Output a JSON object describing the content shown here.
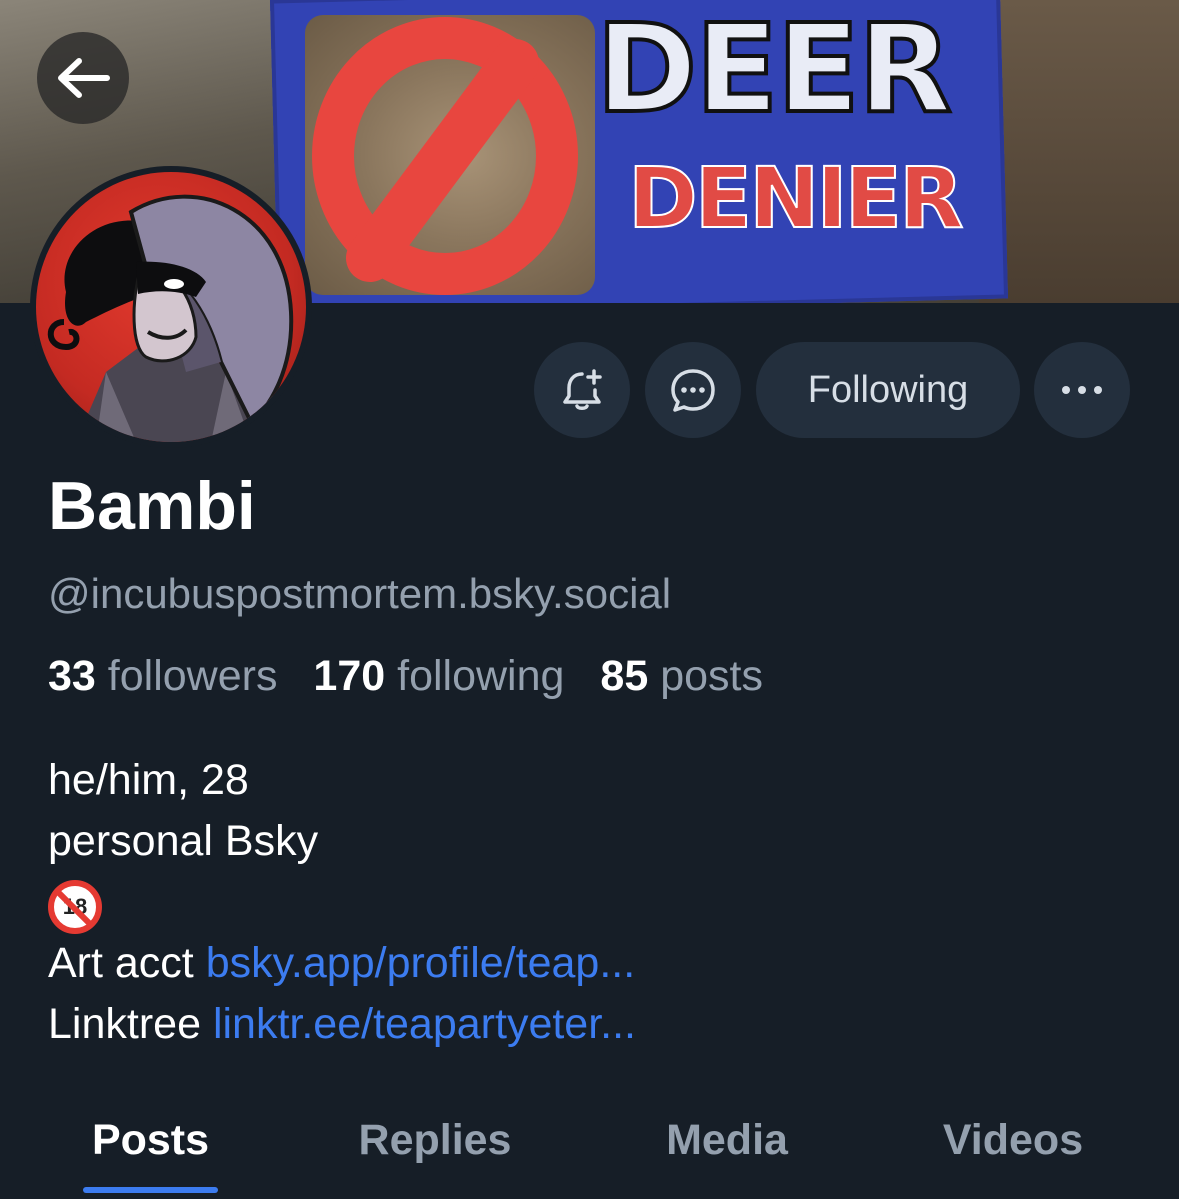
{
  "header": {
    "back_icon": "arrow-left-icon",
    "banner": {
      "sign_text_1": "DEER",
      "sign_text_2": "DENIER"
    }
  },
  "actions": {
    "subscribe_icon": "bell-plus-icon",
    "message_icon": "chat-bubble-icon",
    "follow_label": "Following",
    "more_icon": "ellipsis-icon"
  },
  "profile": {
    "display_name": "Bambi",
    "handle": "@incubuspostmortem.bsky.social",
    "stats": {
      "followers_count": "33",
      "followers_label": "followers",
      "following_count": "170",
      "following_label": "following",
      "posts_count": "85",
      "posts_label": "posts"
    },
    "bio": {
      "line1": "he/him, 28",
      "line2": "personal Bsky",
      "emoji": "18",
      "art_prefix": "Art acct ",
      "art_link": "bsky.app/profile/teap...",
      "linktree_prefix": "Linktree ",
      "linktree_link": "linktr.ee/teapartyeter..."
    }
  },
  "tabs": [
    {
      "label": "Posts",
      "active": true
    },
    {
      "label": "Replies",
      "active": false
    },
    {
      "label": "Media",
      "active": false
    },
    {
      "label": "Videos",
      "active": false
    }
  ],
  "colors": {
    "background": "#161e27",
    "button_bg": "#232f3d",
    "link": "#3c7cf0",
    "muted_text": "#94a0ae"
  }
}
